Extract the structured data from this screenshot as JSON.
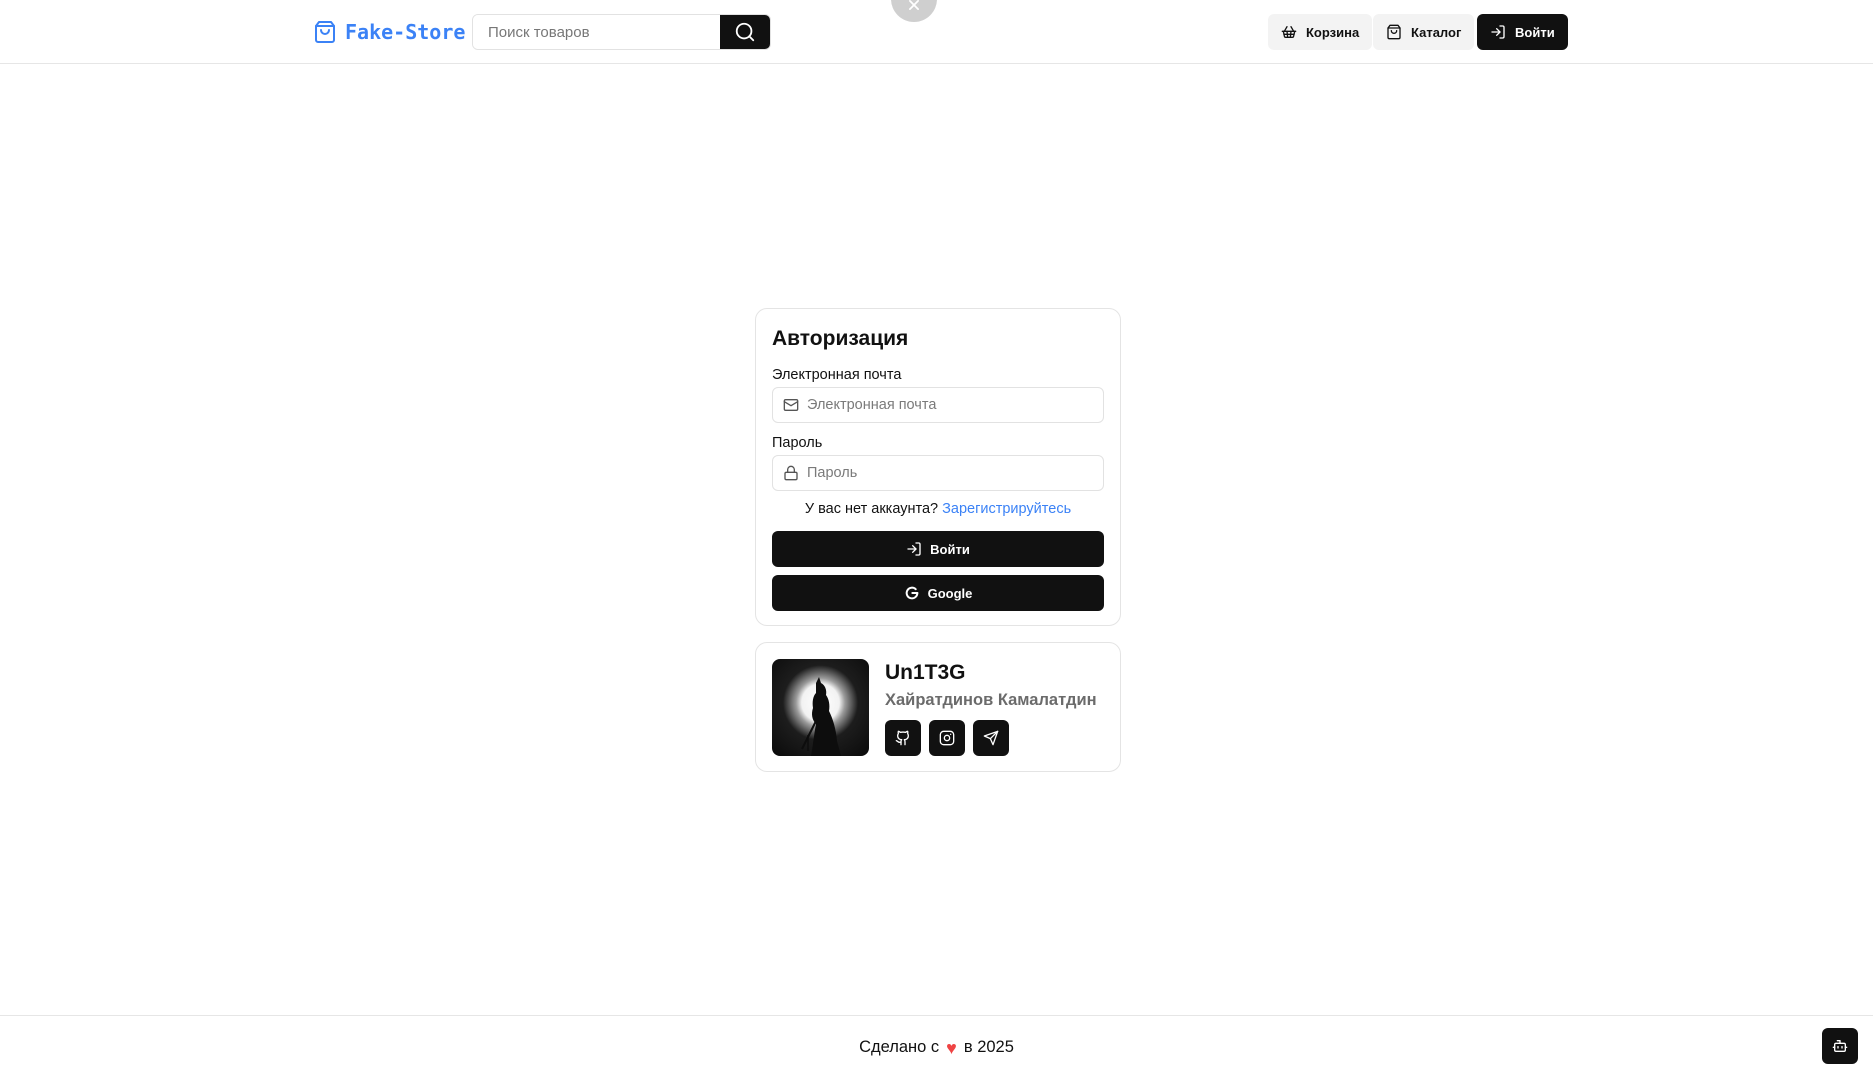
{
  "header": {
    "logo_text": "Fake-Store",
    "search": {
      "placeholder": "Поиск товаров",
      "value": ""
    },
    "nav": {
      "cart_label": "Корзина",
      "catalog_label": "Каталог",
      "login_label": "Войти"
    }
  },
  "auth": {
    "title": "Авторизация",
    "email": {
      "label": "Электронная почта",
      "placeholder": "Электронная почта",
      "value": ""
    },
    "password": {
      "label": "Пароль",
      "placeholder": "Пароль",
      "value": ""
    },
    "no_account_text": "У вас нет аккаунта?",
    "register_link": "Зарегистрируйтесь",
    "login_button": "Войти",
    "google_button": "Google"
  },
  "profile": {
    "nickname": "Un1T3G",
    "full_name": "Хайратдинов Камалатдин",
    "socials": [
      "github-icon",
      "instagram-icon",
      "telegram-icon"
    ]
  },
  "footer": {
    "made_with": "Сделано с",
    "heart": "♥",
    "year_text": "в 2025"
  },
  "colors": {
    "accent": "#3b82f6",
    "dark": "#111111",
    "heart": "#ef4444",
    "muted_text": "#6b6b6b"
  }
}
